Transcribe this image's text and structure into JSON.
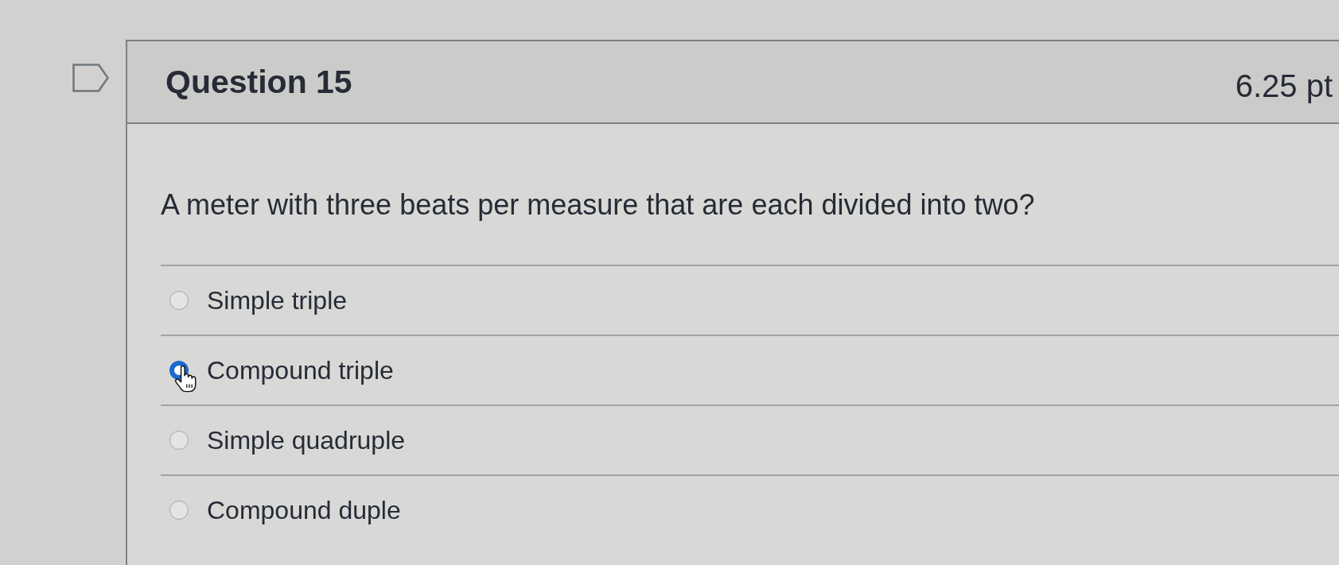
{
  "question": {
    "title": "Question 15",
    "points": "6.25 pt",
    "text": "A meter with three beats per measure that are each divided into two?",
    "answers": [
      {
        "label": "Simple triple",
        "selected": false
      },
      {
        "label": "Compound triple",
        "selected": true
      },
      {
        "label": "Simple quadruple",
        "selected": false
      },
      {
        "label": "Compound duple",
        "selected": false
      }
    ]
  }
}
